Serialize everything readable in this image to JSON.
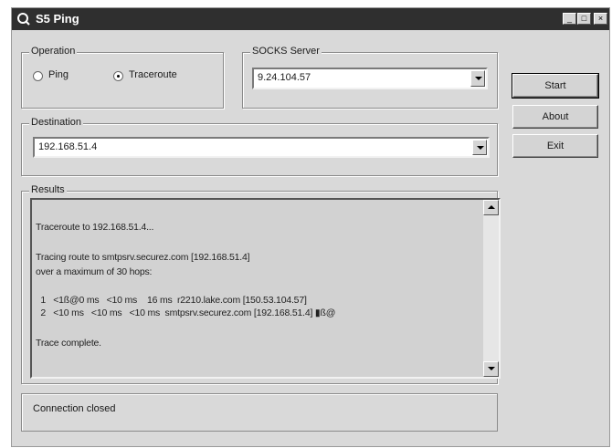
{
  "window": {
    "title": "S5 Ping",
    "icon": "app-icon",
    "controls": {
      "minimize": "_",
      "maximize": "□",
      "close": "×"
    }
  },
  "operation": {
    "legend": "Operation",
    "options": [
      {
        "label": "Ping",
        "selected": false
      },
      {
        "label": "Traceroute",
        "selected": true
      }
    ]
  },
  "socks": {
    "legend": "SOCKS Server",
    "value": "9.24.104.57"
  },
  "destination": {
    "legend": "Destination",
    "value": "192.168.51.4"
  },
  "buttons": {
    "start": "Start",
    "about": "About",
    "exit": "Exit"
  },
  "results": {
    "legend": "Results",
    "lines": [
      "Traceroute to 192.168.51.4...",
      "Tracing route to smtpsrv.securez.com [192.168.51.4]",
      "over a maximum of 30 hops:",
      "  1   <1ß@0 ms   <10 ms    16 ms  r2210.lake.com [150.53.104.57]",
      "  2   <10 ms   <10 ms   <10 ms  smtpsrv.securez.com [192.168.51.4] ▮ß@",
      "Trace complete."
    ]
  },
  "status": {
    "text": "Connection closed"
  }
}
